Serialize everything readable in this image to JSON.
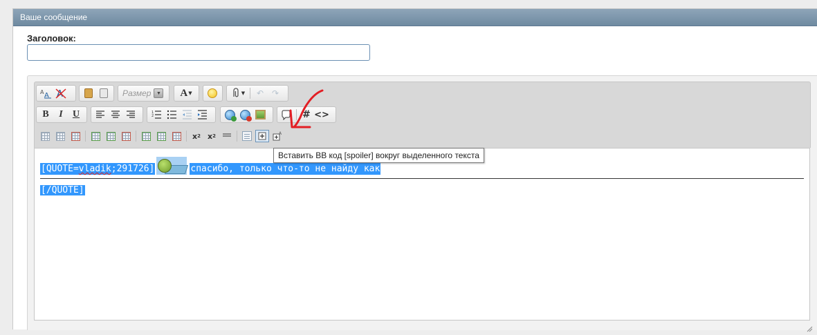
{
  "panel": {
    "title": "Ваше сообщение"
  },
  "form": {
    "title_label": "Заголовок:",
    "title_value": ""
  },
  "toolbar": {
    "size_placeholder": "Размер",
    "buttons": {
      "bold": "B",
      "italic": "I",
      "underline": "U",
      "font": "A",
      "hash": "#",
      "code": "<>",
      "subscript": "x",
      "superscript": "x"
    }
  },
  "tooltip": {
    "text": "Вставить BB код [spoiler] вокруг выделенного текста"
  },
  "content": {
    "quote_open": "[QUOTE=vladik;291726]",
    "quote_name": "vladik",
    "message": " спасибо, только что-то не найду как",
    "quote_close": "[/QUOTE]"
  },
  "colors": {
    "selection": "#3297fd",
    "header": "#7b93a8",
    "annotation": "#e31e24"
  }
}
